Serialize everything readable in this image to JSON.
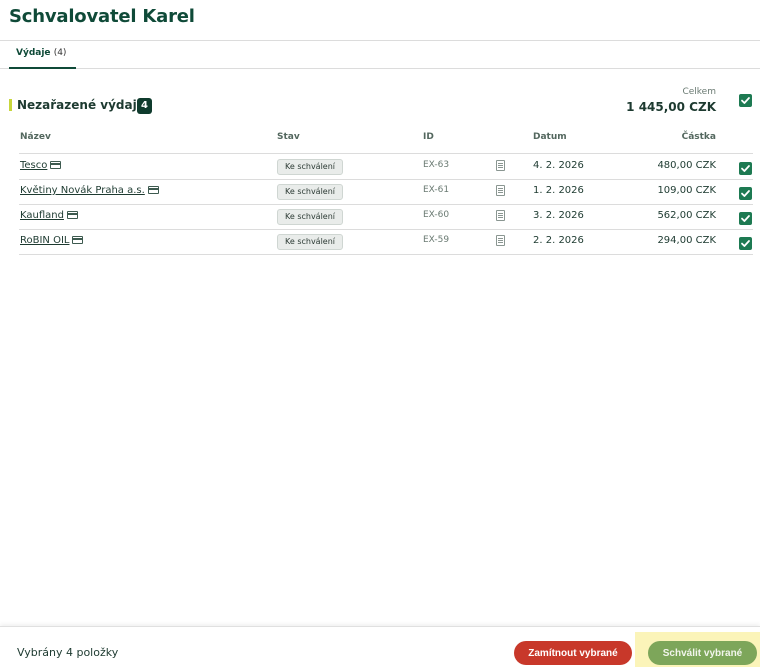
{
  "header": {
    "title": "Schvalovatel Karel"
  },
  "tabs": [
    {
      "label": "Výdaje",
      "count": "(4)"
    }
  ],
  "section": {
    "title": "Nezařazené výdaje",
    "badge": "4",
    "total_label": "Celkem",
    "total_value": "1 445,00 CZK",
    "select_all_checked": true
  },
  "table": {
    "columns": {
      "name": "Název",
      "status": "Stav",
      "id": "ID",
      "date": "Datum",
      "amount": "Částka"
    },
    "rows": [
      {
        "name": "Tesco",
        "status": "Ke schválení",
        "id": "EX-63",
        "date": "4. 2. 2026",
        "amount": "480,00 CZK",
        "checked": true,
        "icon": "card-icon"
      },
      {
        "name": "Květiny Novák Praha a.s.",
        "status": "Ke schválení",
        "id": "EX-61",
        "date": "1. 2. 2026",
        "amount": "109,00 CZK",
        "checked": true,
        "icon": "card-icon"
      },
      {
        "name": "Kaufland",
        "status": "Ke schválení",
        "id": "EX-60",
        "date": "3. 2. 2026",
        "amount": "562,00 CZK",
        "checked": true,
        "icon": "card-icon"
      },
      {
        "name": "RoBIN OIL",
        "status": "Ke schválení",
        "id": "EX-59",
        "date": "2. 2. 2026",
        "amount": "294,00 CZK",
        "checked": true,
        "icon": "card-icon"
      }
    ]
  },
  "footer": {
    "selected_text": "Vybrány 4 položky",
    "reject_label": "Zamítnout vybrané",
    "approve_label": "Schválit vybrané"
  },
  "colors": {
    "brand": "#0f4a38",
    "checkbox": "#1d7a52",
    "reject": "#c8382a",
    "approve": "#7da65a",
    "section_accent": "#c7d63c"
  }
}
